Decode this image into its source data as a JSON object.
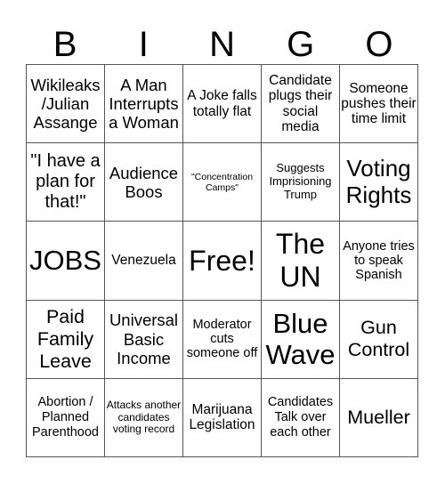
{
  "header": {
    "letters": [
      "B",
      "I",
      "N",
      "G",
      "O"
    ]
  },
  "cells": [
    "Wikileaks /Julian Assange",
    "A Man Interrupts a Woman",
    "A Joke falls totally flat",
    "Candidate plugs their social media",
    "Someone pushes their time limit",
    "\"I have a plan for that!\"",
    "Audience Boos",
    "\"Concentration Camps\"",
    "Suggests Imprisioning Trump",
    "Voting Rights",
    "JOBS",
    "Venezuela",
    "Free!",
    "The UN",
    "Anyone tries to speak Spanish",
    "Paid Family Leave",
    "Universal Basic Income",
    "Moderator cuts someone off",
    "Blue Wave",
    "Gun Control",
    "Abortion / Planned Parenthood",
    "Attacks another candidates voting record",
    "Marijuana Legislation",
    "Candidates Talk over each other",
    "Mueller"
  ]
}
